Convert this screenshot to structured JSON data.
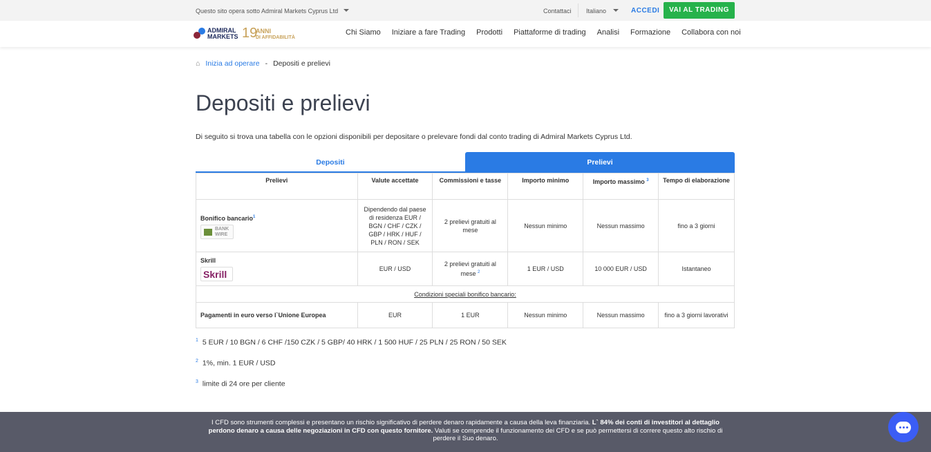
{
  "topbar": {
    "site": "Questo sito opera sotto Admiral Markets Cyprus Ltd",
    "contact": "Contattaci",
    "language": "Italiano",
    "login": "ACCEDI",
    "trade": "VAI AL TRADING"
  },
  "logo": {
    "line1": "ADMIRAL",
    "line2": "MARKETS",
    "years": "19",
    "anni": "ANNI",
    "affid": "DI AFFIDABILITÀ"
  },
  "nav": [
    "Chi Siamo",
    "Iniziare a fare Trading",
    "Prodotti",
    "Piattaforme di trading",
    "Analisi",
    "Formazione",
    "Collabora con noi"
  ],
  "breadcrumb": {
    "parent": "Inizia ad operare",
    "sep": "-",
    "current": "Depositi e prelievi"
  },
  "title": "Depositi e prelievi",
  "intro": "Di seguito si trova una tabella con le opzioni disponibili per depositare o prelevare fondi dal conto trading di Admiral Markets Cyprus Ltd.",
  "tabs": [
    "Depositi",
    "Prelievi"
  ],
  "table": {
    "headers": [
      "Prelievi",
      "Valute accettate",
      "Commissioni e tasse",
      "Importo minimo",
      "Importo massimo",
      "Tempo di elaborazione"
    ],
    "header_sup": "3",
    "rows": [
      {
        "name": "Bonifico bancario",
        "sup": "1",
        "logo": "BANK WIRE",
        "cells": [
          "Dipendendo dal paese di residenza EUR / BGN / CHF / CZK / GBP / HRK / HUF / PLN / RON / SEK",
          "2 prelievi gratuiti al mese",
          "Nessun minimo",
          "Nessun massimo",
          "fino a 3 giorni"
        ]
      },
      {
        "name": "Skrill",
        "logo": "Skrill",
        "cells": [
          "EUR / USD",
          "2 prelievi gratuiti al mese",
          "1 EUR / USD",
          "10 000 EUR / USD",
          "Istantaneo"
        ],
        "sup2": "2"
      }
    ],
    "special": "Condizioni speciali bonifico bancario:",
    "special_row": {
      "name": "Pagamenti in euro verso l`Unione Europea",
      "cells": [
        "EUR",
        "1 EUR",
        "Nessun minimo",
        "Nessun massimo",
        "fino a 3 giorni lavorativi"
      ]
    }
  },
  "notes": [
    {
      "n": "1",
      "text": "5 EUR / 10 BGN / 6 CHF /150 CZK / 5 GBP/ 40 HRK / 1 500 HUF / 25 PLN / 25 RON / 50 SEK"
    },
    {
      "n": "2",
      "text": "1%, min. 1 EUR / USD"
    },
    {
      "n": "3",
      "text": "limite di 24 ore per cliente"
    }
  ],
  "risk": {
    "a": "I CFD sono strumenti complessi e presentano un rischio significativo di perdere denaro rapidamente a causa della leva finanziaria. ",
    "b": "L` 84% dei conti di investitori al dettaglio perdono denaro a causa delle negoziazioni in CFD con questo fornitore.",
    "c": " Valuti se comprende il funzionamento dei CFD e se può permettersi di correre questo alto rischio di perdere il Suo denaro."
  }
}
